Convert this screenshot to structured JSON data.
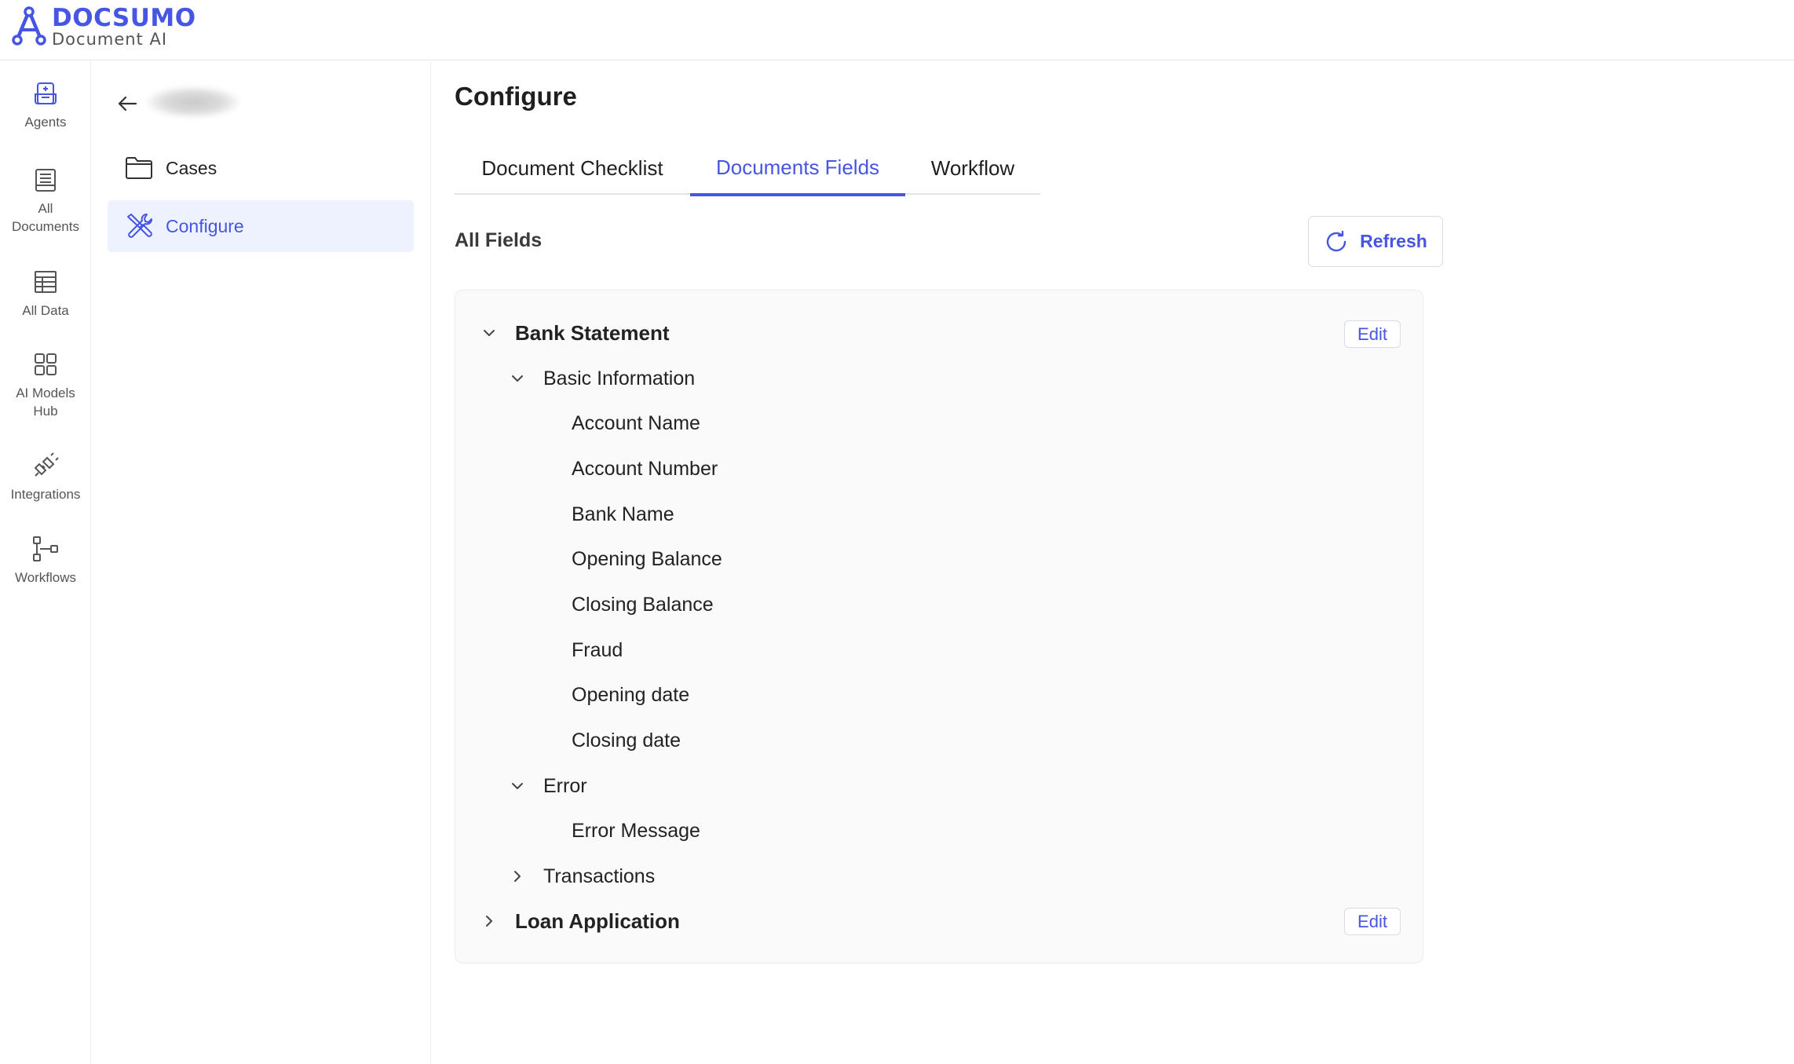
{
  "brand": {
    "name": "DOCSUMO",
    "subtitle": "Document AI",
    "accent": "#4655e3"
  },
  "rail": {
    "items": [
      {
        "label": "Agents",
        "icon": "agents-icon"
      },
      {
        "label": "All Documents",
        "icon": "documents-icon"
      },
      {
        "label": "All Data",
        "icon": "table-icon"
      },
      {
        "label": "AI Models Hub",
        "icon": "grid-icon"
      },
      {
        "label": "Integrations",
        "icon": "plug-icon"
      },
      {
        "label": "Workflows",
        "icon": "workflow-icon"
      }
    ]
  },
  "subnav": {
    "items": [
      {
        "label": "Cases",
        "icon": "folder-icon",
        "active": false
      },
      {
        "label": "Configure",
        "icon": "tools-icon",
        "active": true
      }
    ]
  },
  "main": {
    "title": "Configure",
    "tabs": [
      {
        "label": "Document Checklist",
        "active": false
      },
      {
        "label": "Documents Fields",
        "active": true
      },
      {
        "label": "Workflow",
        "active": false
      }
    ],
    "section_title": "All Fields",
    "refresh_label": "Refresh",
    "edit_label": "Edit",
    "tree": {
      "bank_statement": "Bank Statement",
      "basic_information": "Basic Information",
      "fields": [
        "Account Name",
        "Account Number",
        "Bank Name",
        "Opening Balance",
        "Closing Balance",
        "Fraud",
        "Opening date",
        "Closing date"
      ],
      "error": "Error",
      "error_message": "Error Message",
      "transactions": "Transactions",
      "loan_application": "Loan Application"
    }
  }
}
